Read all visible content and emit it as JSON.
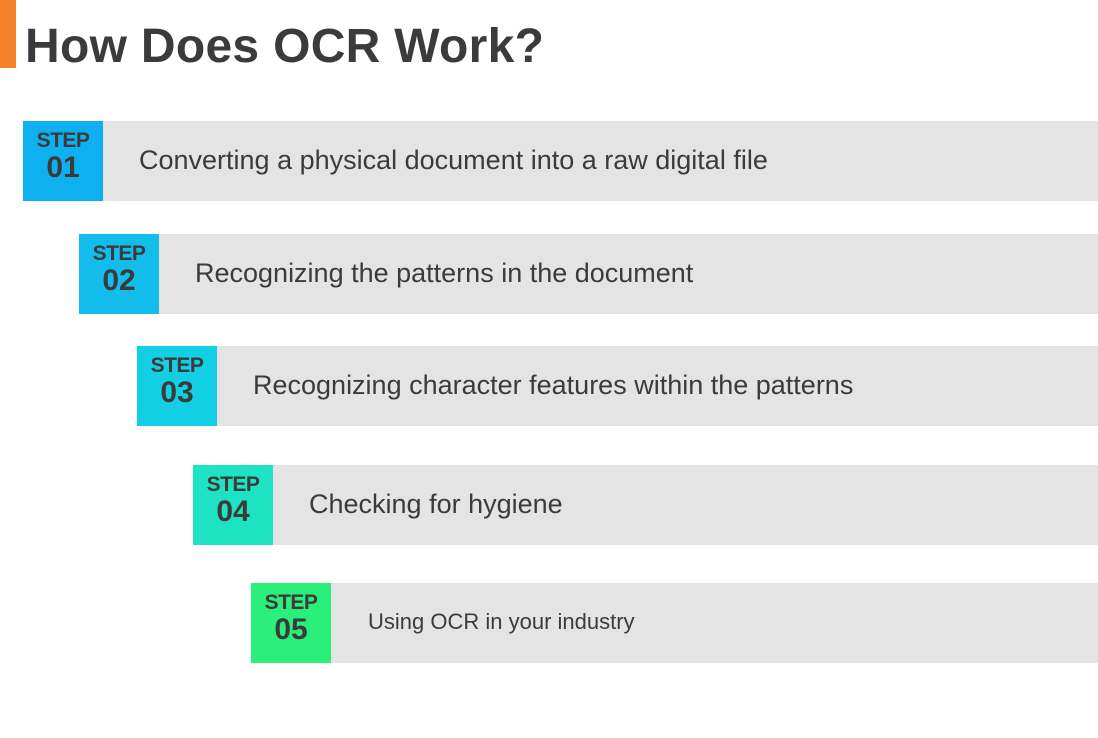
{
  "title": "How Does OCR Work?",
  "colors": {
    "accent": "#f5822a",
    "row_background": "#e4e4e4",
    "text": "#3b3b3b"
  },
  "steps": [
    {
      "label": "STEP",
      "number": "01",
      "text": "Converting a physical document into a raw digital file",
      "color": "#0fb0ef"
    },
    {
      "label": "STEP",
      "number": "02",
      "text": "Recognizing the patterns in the document",
      "color": "#13bdeb"
    },
    {
      "label": "STEP",
      "number": "03",
      "text": "Recognizing character features within the patterns",
      "color": "#12cfe3"
    },
    {
      "label": "STEP",
      "number": "04",
      "text": "Checking for hygiene",
      "color": "#1ee3c2"
    },
    {
      "label": "STEP",
      "number": "05",
      "text": "Using OCR in your industry",
      "color": "#2aef7b"
    }
  ]
}
